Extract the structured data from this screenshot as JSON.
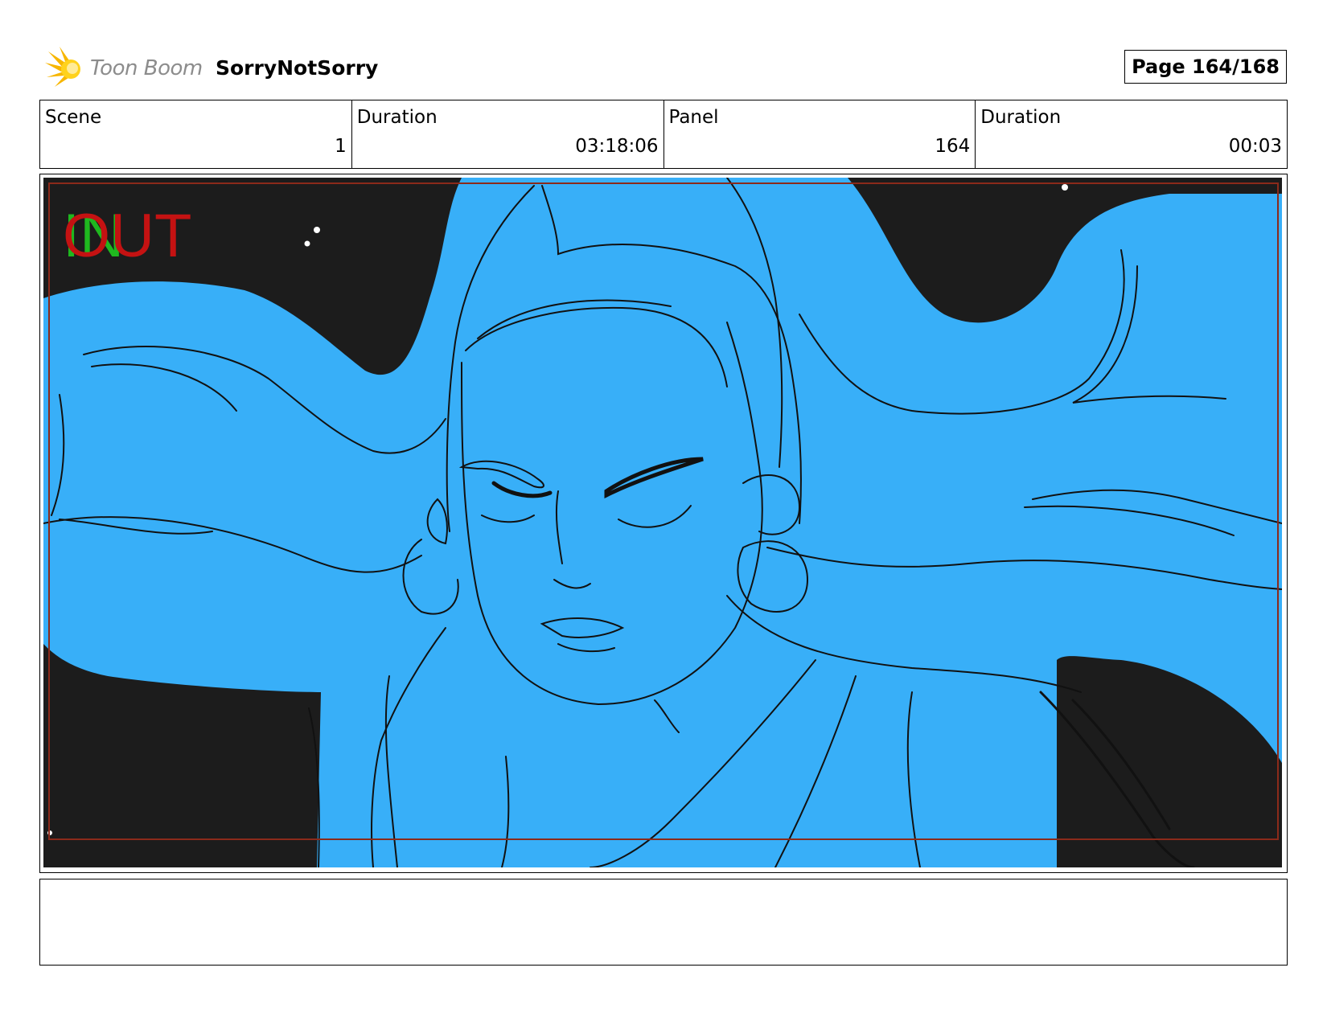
{
  "header": {
    "logo_text": "Toon Boom",
    "project_title": "SorryNotSorry",
    "page_label": "Page 164/168"
  },
  "info": {
    "scene_label": "Scene",
    "scene_value": "1",
    "scene_duration_label": "Duration",
    "scene_duration_value": "03:18:06",
    "panel_label": "Panel",
    "panel_value": "164",
    "panel_duration_label": "Duration",
    "panel_duration_value": "00:03"
  },
  "panel": {
    "in_marker": "IN",
    "out_marker": "OUT",
    "colors": {
      "background": "#1c1c1c",
      "hair_fill": "#38aff8",
      "in_marker": "#1fb81f",
      "out_marker": "#c41212",
      "safe_frame": "#8b2a1a"
    }
  },
  "notes": {
    "text": ""
  }
}
